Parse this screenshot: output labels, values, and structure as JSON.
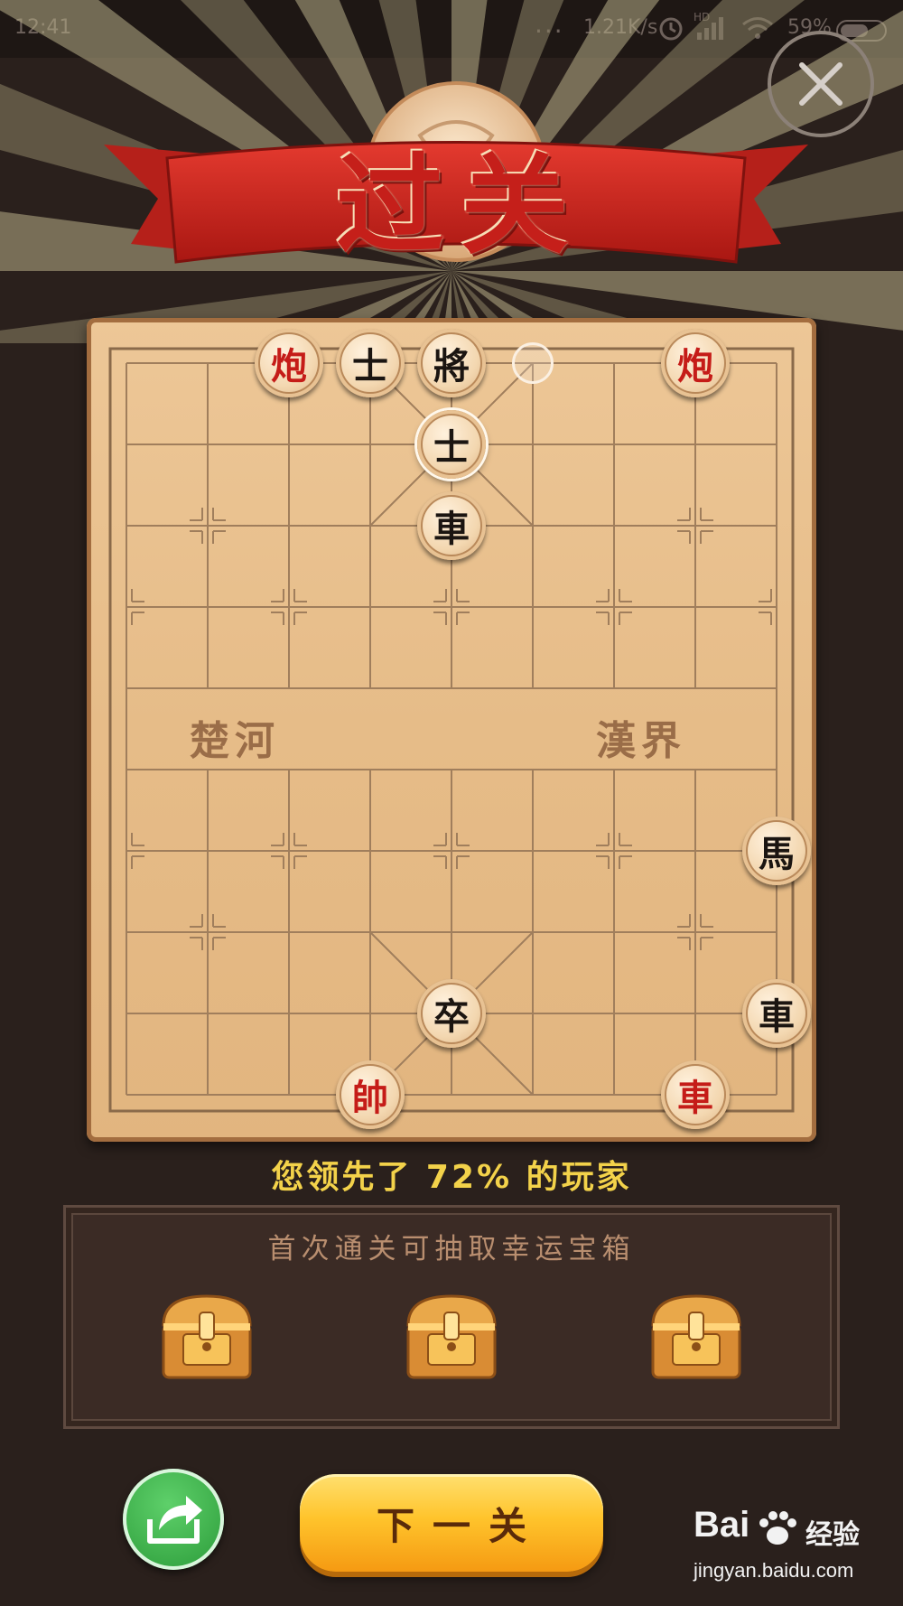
{
  "status_bar": {
    "time": "12:41",
    "dots": "...",
    "network_speed": "1.21K/s",
    "network_type": "HD",
    "battery": "59%"
  },
  "header": {
    "title": "过关",
    "close_icon": "close-icon"
  },
  "board": {
    "river_left": "楚河",
    "river_right": "漢界",
    "pieces": [
      {
        "label": "炮",
        "side": "red",
        "col": 2,
        "row": 0
      },
      {
        "label": "士",
        "side": "black",
        "col": 3,
        "row": 0
      },
      {
        "label": "將",
        "side": "black",
        "col": 4,
        "row": 0
      },
      {
        "label": "炮",
        "side": "red",
        "col": 7,
        "row": 0
      },
      {
        "label": "士",
        "side": "black",
        "col": 4,
        "row": 1,
        "selected": true
      },
      {
        "label": "車",
        "side": "black",
        "col": 4,
        "row": 2
      },
      {
        "label": "馬",
        "side": "black",
        "col": 8,
        "row": 6
      },
      {
        "label": "卒",
        "side": "black",
        "col": 4,
        "row": 8
      },
      {
        "label": "車",
        "side": "black",
        "col": 8,
        "row": 8
      },
      {
        "label": "帥",
        "side": "red",
        "col": 3,
        "row": 9
      },
      {
        "label": "車",
        "side": "red",
        "col": 7,
        "row": 9
      }
    ],
    "move_marker": {
      "col": 5,
      "row": 0
    }
  },
  "result": {
    "lead_text": "您领先了 72% 的玩家"
  },
  "rewards": {
    "title": "首次通关可抽取幸运宝箱",
    "chests": [
      {
        "icon": "treasure-chest-icon"
      },
      {
        "icon": "treasure-chest-icon"
      },
      {
        "icon": "treasure-chest-icon"
      }
    ]
  },
  "actions": {
    "share_icon": "share-icon",
    "next_label": "下一关"
  },
  "watermark": {
    "brand": "Bai",
    "brand_cn": "经验",
    "url": "jingyan.baidu.com"
  },
  "colors": {
    "background": "#2a201c",
    "board": "#e6bc88",
    "red_piece_text": "#c51c18",
    "black_piece_text": "#1b1511",
    "lead_text": "#f3d24a",
    "next_button": "#ffc42c",
    "share_button": "#2a9a38"
  }
}
